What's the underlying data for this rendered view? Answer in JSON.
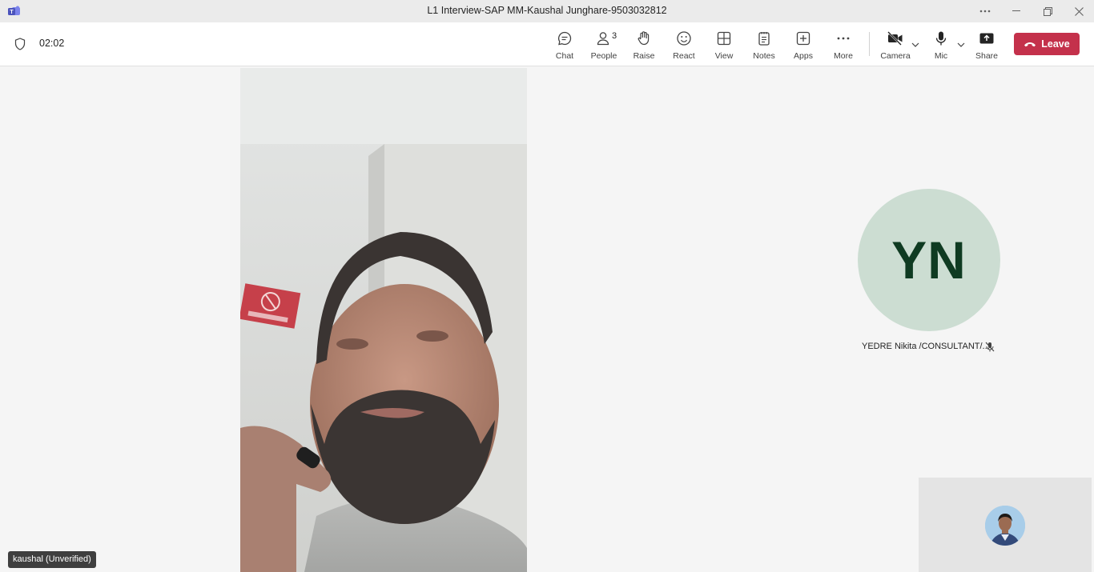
{
  "window": {
    "title": "L1 Interview-SAP MM-Kaushal Junghare-9503032812",
    "more_icon": "more-horizontal-icon",
    "minimize_icon": "minimize-icon",
    "restore_icon": "restore-icon",
    "close_icon": "close-icon"
  },
  "meeting": {
    "timer": "02:02"
  },
  "toolbar": {
    "chat": "Chat",
    "people": "People",
    "people_count": "3",
    "raise": "Raise",
    "react": "React",
    "view": "View",
    "notes": "Notes",
    "apps": "Apps",
    "more": "More",
    "camera": "Camera",
    "mic": "Mic",
    "share": "Share",
    "leave": "Leave"
  },
  "participants": {
    "remote_video_name": "kaushal (Unverified)",
    "avatar_initials": "YN",
    "avatar_name": "YEDRE Nikita /CONSULTANT/...",
    "avatar_muted": true
  },
  "colors": {
    "leave": "#c4314b",
    "avatar_bg": "#ccddd2",
    "avatar_text": "#0f3b22",
    "stage_bg": "#f5f5f5"
  }
}
